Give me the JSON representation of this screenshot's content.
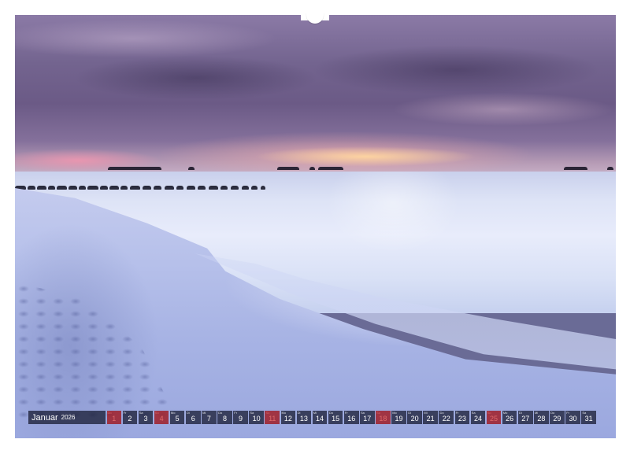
{
  "calendar": {
    "month": "Januar",
    "year": "2026",
    "days": [
      {
        "dow": "Do",
        "num": "1",
        "weekend": true
      },
      {
        "dow": "Fr",
        "num": "2",
        "weekend": false
      },
      {
        "dow": "Sa",
        "num": "3",
        "weekend": false
      },
      {
        "dow": "So",
        "num": "4",
        "weekend": true
      },
      {
        "dow": "Mo",
        "num": "5",
        "weekend": false
      },
      {
        "dow": "Di",
        "num": "6",
        "weekend": false
      },
      {
        "dow": "Mi",
        "num": "7",
        "weekend": false
      },
      {
        "dow": "Do",
        "num": "8",
        "weekend": false
      },
      {
        "dow": "Fr",
        "num": "9",
        "weekend": false
      },
      {
        "dow": "Sa",
        "num": "10",
        "weekend": false
      },
      {
        "dow": "So",
        "num": "11",
        "weekend": true
      },
      {
        "dow": "Mo",
        "num": "12",
        "weekend": false
      },
      {
        "dow": "Di",
        "num": "13",
        "weekend": false
      },
      {
        "dow": "Mi",
        "num": "14",
        "weekend": false
      },
      {
        "dow": "Do",
        "num": "15",
        "weekend": false
      },
      {
        "dow": "Fr",
        "num": "16",
        "weekend": false
      },
      {
        "dow": "Sa",
        "num": "17",
        "weekend": false
      },
      {
        "dow": "So",
        "num": "18",
        "weekend": true
      },
      {
        "dow": "Mo",
        "num": "19",
        "weekend": false
      },
      {
        "dow": "Di",
        "num": "20",
        "weekend": false
      },
      {
        "dow": "Mi",
        "num": "21",
        "weekend": false
      },
      {
        "dow": "Do",
        "num": "22",
        "weekend": false
      },
      {
        "dow": "Fr",
        "num": "23",
        "weekend": false
      },
      {
        "dow": "Sa",
        "num": "24",
        "weekend": false
      },
      {
        "dow": "So",
        "num": "25",
        "weekend": true
      },
      {
        "dow": "Mo",
        "num": "26",
        "weekend": false
      },
      {
        "dow": "Di",
        "num": "27",
        "weekend": false
      },
      {
        "dow": "Mi",
        "num": "28",
        "weekend": false
      },
      {
        "dow": "Do",
        "num": "29",
        "weekend": false
      },
      {
        "dow": "Fr",
        "num": "30",
        "weekend": false
      },
      {
        "dow": "Sa",
        "num": "31",
        "weekend": false
      }
    ]
  },
  "colors": {
    "weekday_cell": "#1c2038",
    "weekend_cell": "#a01e28",
    "sky_top": "#8b7aa6",
    "sunset_glow": "#ffd6a0",
    "sea": "#dde3f6",
    "sand": "#a7b3e4"
  }
}
